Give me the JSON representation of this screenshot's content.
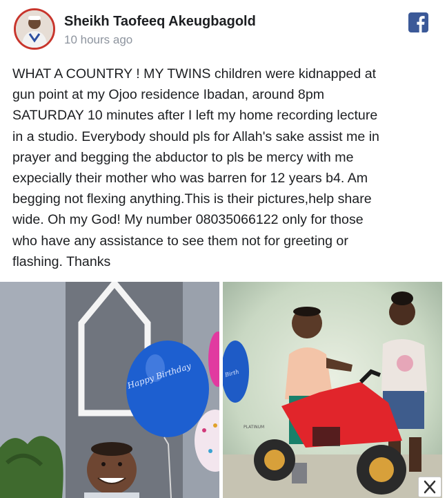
{
  "post": {
    "author": "Sheikh Taofeeq Akeugbagold",
    "timestamp": "10 hours ago",
    "text_lines": [
      "WHAT A COUNTRY ! MY TWINS children were kidnapped at",
      "gun point at my Ojoo residence Ibadan, around 8pm",
      "SATURDAY 10 minutes after I left my home recording lecture",
      "in a studio. Everybody should pls for Allah's sake assist me in",
      "prayer and begging the abductor to pls be mercy with me",
      "expecially their mother who was barren for 12 years b4. Am",
      "begging not flexing anything.This is their pictures,help share",
      "wide. Oh my God! My number 08035066122 only for those",
      "who have any assistance to see them not for greeting or",
      "flashing. Thanks"
    ]
  },
  "icons": {
    "platform": "facebook-icon",
    "close": "close-icon"
  },
  "colors": {
    "facebook_blue": "#3b5998",
    "avatar_ring": "#c8352c",
    "timestamp_gray": "#8d949e",
    "balloon_blue": "#1d5fd0"
  },
  "photos": {
    "left_balloon_text": "Happy Birthday",
    "right_watermark": "PLATINUM"
  }
}
